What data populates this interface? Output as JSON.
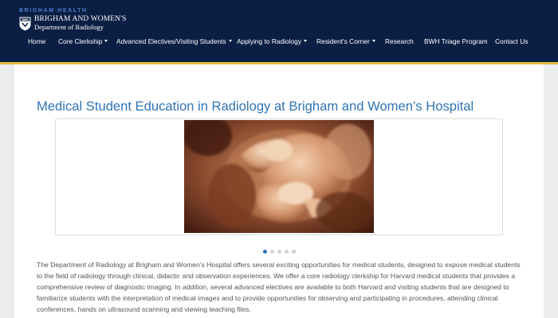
{
  "brand": {
    "top": "BRIGHAM HEALTH",
    "shield": "BWH",
    "name": "BRIGHAM AND WOMEN'S",
    "dept": "Department of Radiology"
  },
  "nav": [
    {
      "label": "Home",
      "dropdown": false
    },
    {
      "label": "Core Clerkship",
      "dropdown": true
    },
    {
      "label": "Advanced Electives/Visiting Students",
      "dropdown": true
    },
    {
      "label": "Applying to Radiology",
      "dropdown": true
    },
    {
      "label": "Resident's Corner",
      "dropdown": true
    },
    {
      "label": "Research",
      "dropdown": false
    },
    {
      "label": "BWH Triage Program",
      "dropdown": false
    },
    {
      "label": "Contact Us",
      "dropdown": false
    }
  ],
  "page": {
    "title": "Medical Student Education in Radiology at Brigham and Women’s Hospital",
    "intro": "The Department of Radiology at Brigham and Women’s Hospital offers several exciting opportunities for medical students, designed to expose medical students to the field of radiology through clinical, didactic and observation experiences. We offer a core radiology clerkship for Harvard medical students that provides a comprehensive review of diagnostic imaging. In addition, several advanced electives are available to both Harvard and visiting students that are designed to familiarize students with the interpretation of medical images and to provide opportunities for observing and participating in procedures, attending clinical conferences, hands on ultrasound scanning and viewing teaching files."
  },
  "slider": {
    "slide_count": 5,
    "active_index": 0
  },
  "colors": {
    "header_bg": "#0b1f44",
    "accent_gold": "#e0b73d",
    "title_blue": "#2f74b5",
    "body_text": "#555555"
  }
}
